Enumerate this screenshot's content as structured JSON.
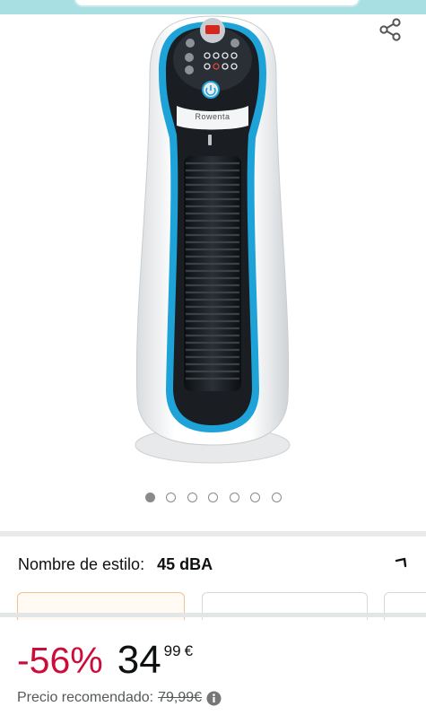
{
  "colors": {
    "top_bar": "#a8dfe3",
    "discount": "#cc0c39",
    "selected_option_border": "#f3c18b",
    "fan_accent": "#1ea3d8"
  },
  "icons": {
    "share": "share-icon",
    "collapse": "chevron-up-icon",
    "info": "info-icon"
  },
  "product": {
    "brand_on_device": "Rowenta"
  },
  "carousel": {
    "total_images": 7,
    "active_index": 0
  },
  "style_selector": {
    "label": "Nombre de estilo:",
    "value": "45 dBA",
    "options_visible": 3,
    "selected_index": 0
  },
  "price": {
    "discount": "-56%",
    "whole": "34",
    "fraction": "99",
    "currency": "€",
    "list_price_label": "Precio recomendado:",
    "list_price": "79,99€"
  }
}
